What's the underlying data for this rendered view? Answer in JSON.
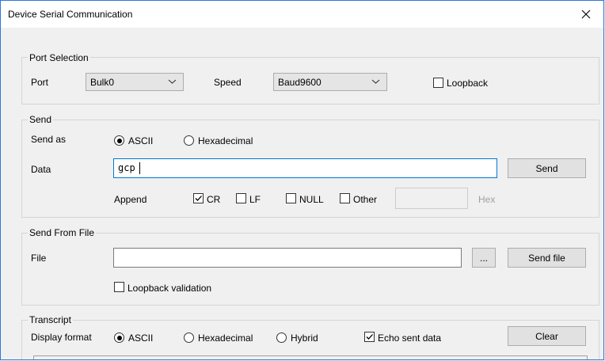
{
  "window": {
    "title": "Device Serial Communication",
    "close_glyph": "✕"
  },
  "port_selection": {
    "group_label": "Port Selection",
    "port_label": "Port",
    "port_value": "Bulk0",
    "speed_label": "Speed",
    "speed_value": "Baud9600",
    "loopback_label": "Loopback",
    "loopback_checked": false
  },
  "send": {
    "group_label": "Send",
    "send_as_label": "Send as",
    "radio_ascii": "ASCII",
    "radio_hex": "Hexadecimal",
    "selected": "ASCII",
    "data_label": "Data",
    "data_value": "gcp",
    "send_button": "Send",
    "append_label": "Append",
    "append_cr": "CR",
    "append_lf": "LF",
    "append_null": "NULL",
    "append_other": "Other",
    "hex_label": "Hex",
    "cr_checked": true,
    "lf_checked": false,
    "null_checked": false,
    "other_checked": false
  },
  "send_from_file": {
    "group_label": "Send From File",
    "file_label": "File",
    "file_value": "",
    "browse_button": "...",
    "send_file_button": "Send file",
    "loopback_validation_label": "Loopback validation",
    "loopback_validation_checked": false
  },
  "transcript": {
    "group_label": "Transcript",
    "display_format_label": "Display format",
    "radio_ascii": "ASCII",
    "radio_hex": "Hexadecimal",
    "radio_hybrid": "Hybrid",
    "selected": "ASCII",
    "echo_label": "Echo sent data",
    "echo_checked": true,
    "clear_button": "Clear"
  }
}
